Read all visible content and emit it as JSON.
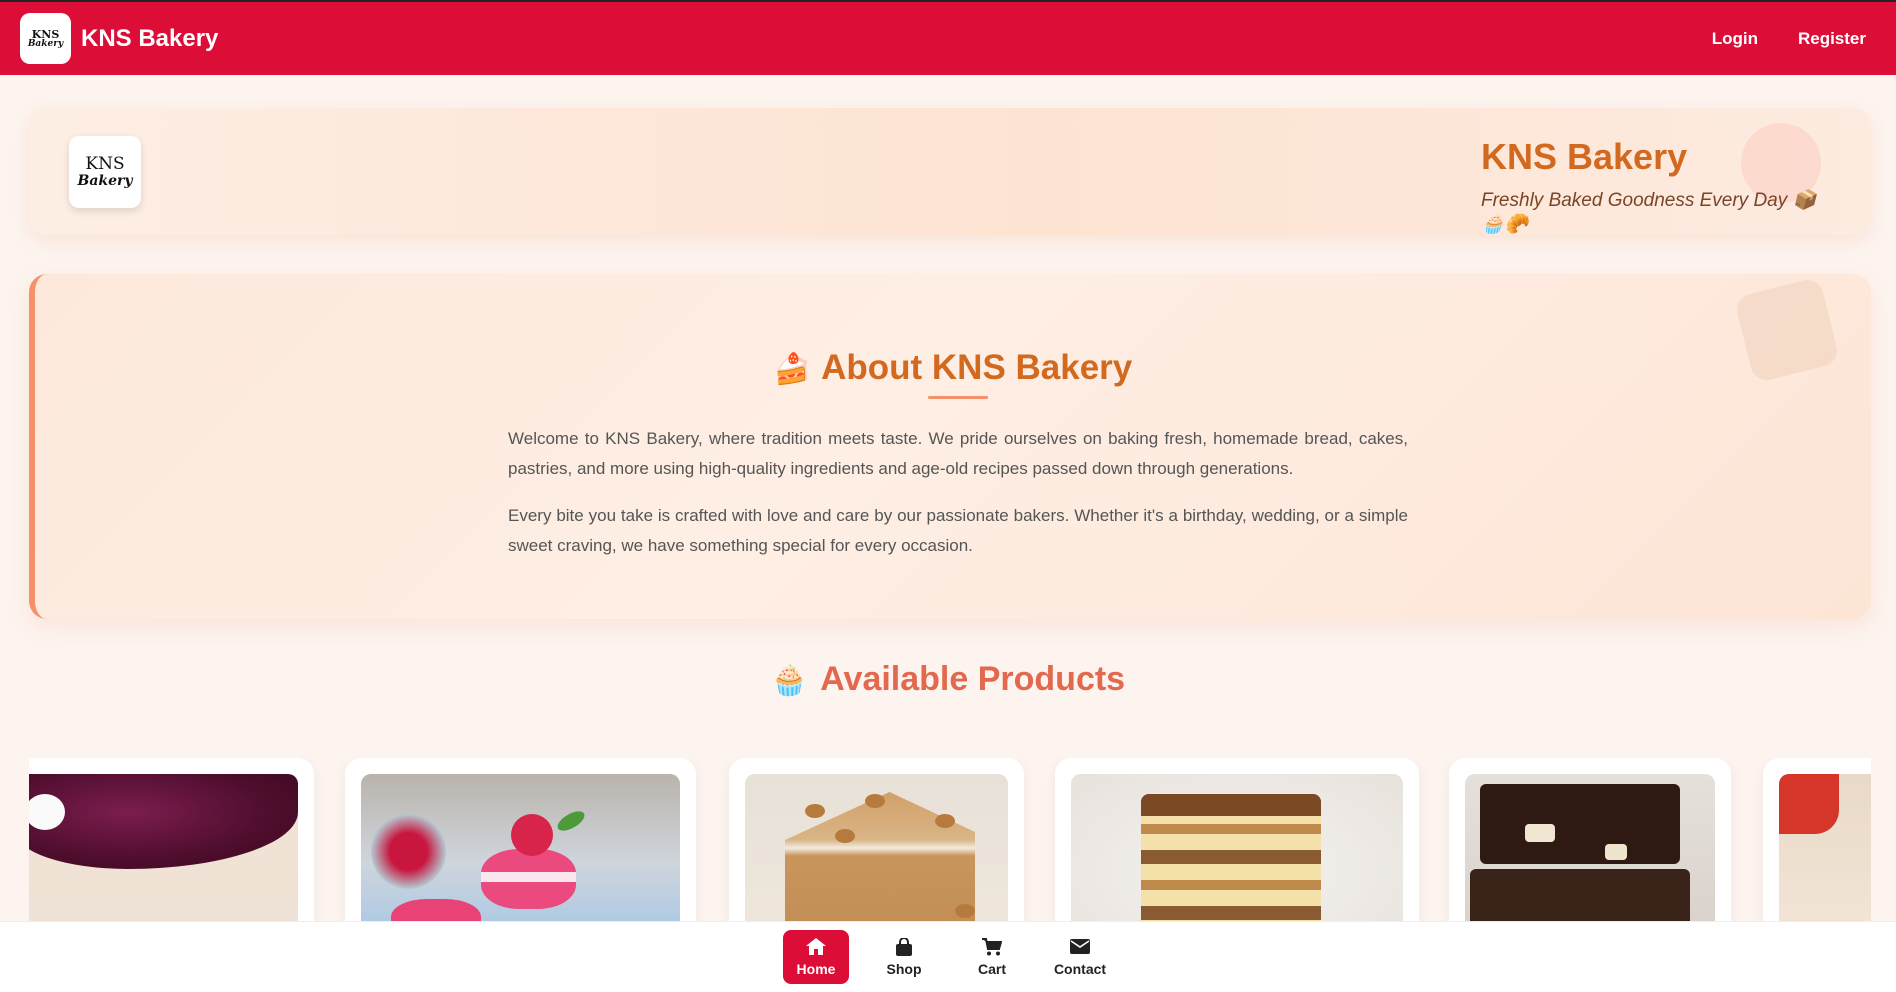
{
  "navbar": {
    "brand_name": "KNS Bakery",
    "logo_text_top": "KNS",
    "logo_text_bottom": "Bakery",
    "links": [
      {
        "label": "Login"
      },
      {
        "label": "Register"
      }
    ]
  },
  "hero": {
    "logo_text_top": "KNS",
    "logo_text_bottom": "Bakery",
    "title": "KNS Bakery",
    "subtitle": "Freshly Baked Goodness Every Day 📦🧁🥐"
  },
  "about": {
    "emoji": "🍰",
    "heading": "About KNS Bakery",
    "paragraphs": [
      "Welcome to KNS Bakery, where tradition meets taste. We pride ourselves on baking fresh, homemade bread, cakes, pastries, and more using high-quality ingredients and age-old recipes passed down through generations.",
      "Every bite you take is crafted with love and care by our passionate bakers. Whether it's a birthday, wedding, or a simple sweet craving, we have something special for every occasion."
    ]
  },
  "products": {
    "emoji": "🧁",
    "heading": "Available Products"
  },
  "tabbar": {
    "tabs": [
      {
        "label": "Home",
        "icon": "home-icon",
        "active": true
      },
      {
        "label": "Shop",
        "icon": "shopping-bag-icon",
        "active": false
      },
      {
        "label": "Cart",
        "icon": "cart-icon",
        "active": false
      },
      {
        "label": "Contact",
        "icon": "envelope-icon",
        "active": false
      }
    ]
  },
  "colors": {
    "brand_red": "#dc0d36",
    "accent_orange": "#d2691e",
    "products_heading": "#e2684e"
  }
}
